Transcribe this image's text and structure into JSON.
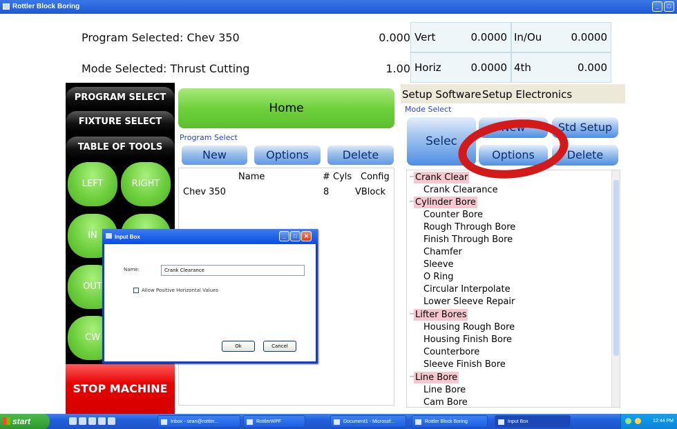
{
  "window": {
    "title": "Rottler Block Boring"
  },
  "header": {
    "program_label": "Program Selected:",
    "program_value": "Chev 350",
    "mode_label": "Mode Selected:",
    "mode_value": "Thrust Cutting",
    "readouts": [
      {
        "value": "0.000"
      },
      {
        "value": "1.00"
      }
    ],
    "axes": [
      {
        "label": "Vert",
        "value": "0.0000"
      },
      {
        "label": "In/Ou",
        "value": "0.0000"
      },
      {
        "label": "Horiz",
        "value": "0.0000"
      },
      {
        "label": "4th",
        "value": "0.000"
      }
    ]
  },
  "left_panel": {
    "program_select": "PROGRAM SELECT",
    "fixture_select": "FIXTURE SELECT",
    "table_of_tools": "TABLE OF TOOLS",
    "left": "LEFT",
    "right": "RIGHT",
    "in": "IN",
    "out": "OUT",
    "cw": "CW",
    "stop": "STOP MACHINE"
  },
  "program_panel": {
    "home": "Home",
    "section_label": "Program Select",
    "new": "New",
    "options": "Options",
    "delete": "Delete",
    "columns": [
      "Name",
      "# Cyls",
      "Config"
    ],
    "rows": [
      {
        "name": "Chev 350",
        "cyls": "8",
        "config": "VBlock"
      }
    ]
  },
  "setup_panel": {
    "tab_software": "Setup Software",
    "tab_electronics": "Setup Electronics",
    "mode_select_label": "Mode Select",
    "select": "Selec",
    "new": "New",
    "std_setup": "Std Setup",
    "options": "Options",
    "delete": "Delete",
    "tree": [
      {
        "category": "Crank Clear",
        "items": [
          "Crank Clearance"
        ]
      },
      {
        "category": "Cylinder Bore",
        "items": [
          "Counter Bore",
          "Rough Through Bore",
          "Finish Through Bore",
          "Chamfer",
          "Sleeve",
          "O Ring",
          "Circular Interpolate",
          "Lower Sleeve Repair"
        ]
      },
      {
        "category": "Lifter Bores",
        "items": [
          "Housing Rough Bore",
          "Housing Finish Bore",
          "Counterbore",
          "Sleeve Finish Bore"
        ]
      },
      {
        "category": "Line Bore",
        "items": [
          "Line Bore",
          "Cam Bore"
        ]
      }
    ]
  },
  "dialog": {
    "title": "Input Box",
    "name_label": "Name:",
    "name_value": "Crank Clearance",
    "checkbox_label": "Allow Positive Horizontal Values",
    "checkbox_checked": false,
    "ok": "Ok",
    "cancel": "Cancel"
  },
  "taskbar": {
    "start": "start",
    "tasks": [
      "Inbox - sean@rottler...",
      "RottlerWPF",
      "Document1 - Microsof...",
      "Rottler Block Boring",
      "Input Box"
    ],
    "clock": "12:44 PM"
  },
  "colors": {
    "accent_green": "#6fd03d",
    "stop_red": "#e60000",
    "button_blue": "#5f98e4",
    "annotation_red": "#d31a1a",
    "category_pink": "#f7c7d0"
  }
}
